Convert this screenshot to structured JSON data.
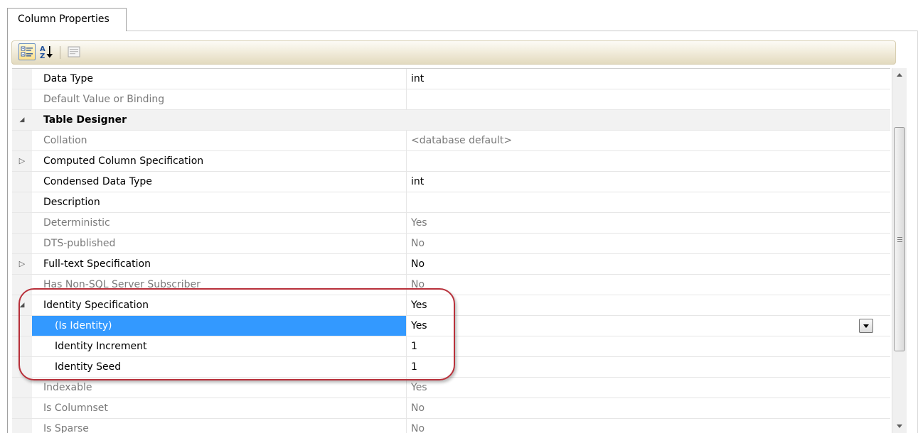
{
  "tab": {
    "label": "Column Properties"
  },
  "toolbar": {
    "categorized_tooltip": "",
    "alphabetical_tooltip": ""
  },
  "properties": [
    {
      "kind": "property",
      "name": "Data Type",
      "value": "int",
      "muted": false,
      "bold": false,
      "expander": ""
    },
    {
      "kind": "property",
      "name": "Default Value or Binding",
      "value": "",
      "muted": true,
      "bold": false,
      "expander": ""
    },
    {
      "kind": "category",
      "name": "Table Designer",
      "value": "",
      "muted": false,
      "bold": true,
      "expander": "collapse"
    },
    {
      "kind": "property",
      "name": "Collation",
      "value": "<database default>",
      "muted": true,
      "bold": false,
      "expander": ""
    },
    {
      "kind": "property",
      "name": "Computed Column Specification",
      "value": "",
      "muted": false,
      "bold": false,
      "expander": "expand"
    },
    {
      "kind": "property",
      "name": "Condensed Data Type",
      "value": "int",
      "muted": false,
      "bold": false,
      "expander": ""
    },
    {
      "kind": "property",
      "name": "Description",
      "value": "",
      "muted": false,
      "bold": false,
      "expander": ""
    },
    {
      "kind": "property",
      "name": "Deterministic",
      "value": "Yes",
      "muted": true,
      "bold": false,
      "expander": ""
    },
    {
      "kind": "property",
      "name": "DTS-published",
      "value": "No",
      "muted": true,
      "bold": false,
      "expander": ""
    },
    {
      "kind": "property",
      "name": "Full-text Specification",
      "value": "No",
      "muted": false,
      "bold": false,
      "expander": "expand"
    },
    {
      "kind": "property",
      "name": "Has Non-SQL Server Subscriber",
      "value": "No",
      "muted": true,
      "bold": false,
      "expander": ""
    },
    {
      "kind": "property",
      "name": "Identity Specification",
      "value": "Yes",
      "muted": false,
      "bold": false,
      "expander": "collapse"
    },
    {
      "kind": "property",
      "name": "(Is Identity)",
      "value": "Yes",
      "muted": false,
      "bold": false,
      "expander": "",
      "indent": true,
      "selected": true
    },
    {
      "kind": "property",
      "name": "Identity Increment",
      "value": "1",
      "muted": false,
      "bold": false,
      "expander": "",
      "indent": true
    },
    {
      "kind": "property",
      "name": "Identity Seed",
      "value": "1",
      "muted": false,
      "bold": false,
      "expander": "",
      "indent": true
    },
    {
      "kind": "property",
      "name": "Indexable",
      "value": "Yes",
      "muted": true,
      "bold": false,
      "expander": ""
    },
    {
      "kind": "property",
      "name": "Is Columnset",
      "value": "No",
      "muted": true,
      "bold": false,
      "expander": ""
    },
    {
      "kind": "property",
      "name": "Is Sparse",
      "value": "No",
      "muted": true,
      "bold": false,
      "expander": ""
    }
  ],
  "colors": {
    "selection": "#3399ff",
    "highlight_ring": "#b8303a",
    "muted_text": "#7a7a7a"
  }
}
